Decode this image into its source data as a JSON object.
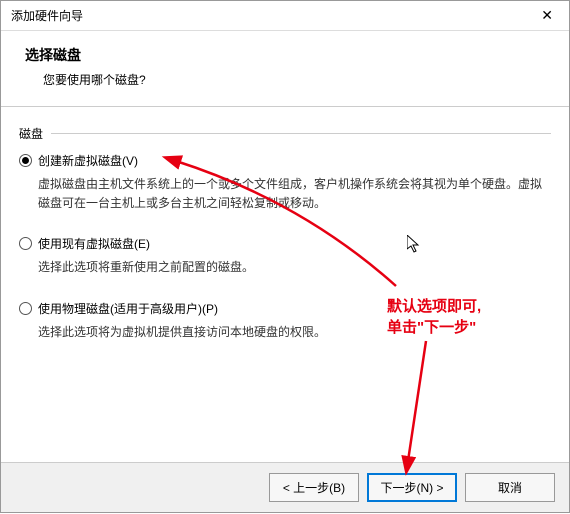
{
  "window": {
    "title": "添加硬件向导"
  },
  "header": {
    "title": "选择磁盘",
    "subtitle": "您要使用哪个磁盘?"
  },
  "fieldset": {
    "label": "磁盘"
  },
  "options": {
    "create": {
      "label": "创建新虚拟磁盘(V)",
      "desc": "虚拟磁盘由主机文件系统上的一个或多个文件组成，客户机操作系统会将其视为单个硬盘。虚拟磁盘可在一台主机上或多台主机之间轻松复制或移动。"
    },
    "existing": {
      "label": "使用现有虚拟磁盘(E)",
      "desc": "选择此选项将重新使用之前配置的磁盘。"
    },
    "physical": {
      "label": "使用物理磁盘(适用于高级用户)(P)",
      "desc": "选择此选项将为虚拟机提供直接访问本地硬盘的权限。"
    }
  },
  "buttons": {
    "back": "< 上一步(B)",
    "next": "下一步(N) >",
    "cancel": "取消"
  },
  "annotation": {
    "line1": "默认选项即可,",
    "line2": "单击\"下一步\""
  }
}
